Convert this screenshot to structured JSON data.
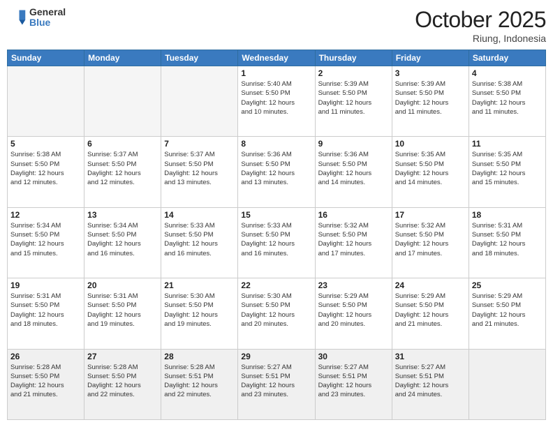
{
  "header": {
    "logo": {
      "general": "General",
      "blue": "Blue"
    },
    "title": "October 2025",
    "location": "Riung, Indonesia"
  },
  "weekdays": [
    "Sunday",
    "Monday",
    "Tuesday",
    "Wednesday",
    "Thursday",
    "Friday",
    "Saturday"
  ],
  "weeks": [
    [
      {
        "day": "",
        "info": ""
      },
      {
        "day": "",
        "info": ""
      },
      {
        "day": "",
        "info": ""
      },
      {
        "day": "1",
        "info": "Sunrise: 5:40 AM\nSunset: 5:50 PM\nDaylight: 12 hours\nand 10 minutes."
      },
      {
        "day": "2",
        "info": "Sunrise: 5:39 AM\nSunset: 5:50 PM\nDaylight: 12 hours\nand 11 minutes."
      },
      {
        "day": "3",
        "info": "Sunrise: 5:39 AM\nSunset: 5:50 PM\nDaylight: 12 hours\nand 11 minutes."
      },
      {
        "day": "4",
        "info": "Sunrise: 5:38 AM\nSunset: 5:50 PM\nDaylight: 12 hours\nand 11 minutes."
      }
    ],
    [
      {
        "day": "5",
        "info": "Sunrise: 5:38 AM\nSunset: 5:50 PM\nDaylight: 12 hours\nand 12 minutes."
      },
      {
        "day": "6",
        "info": "Sunrise: 5:37 AM\nSunset: 5:50 PM\nDaylight: 12 hours\nand 12 minutes."
      },
      {
        "day": "7",
        "info": "Sunrise: 5:37 AM\nSunset: 5:50 PM\nDaylight: 12 hours\nand 13 minutes."
      },
      {
        "day": "8",
        "info": "Sunrise: 5:36 AM\nSunset: 5:50 PM\nDaylight: 12 hours\nand 13 minutes."
      },
      {
        "day": "9",
        "info": "Sunrise: 5:36 AM\nSunset: 5:50 PM\nDaylight: 12 hours\nand 14 minutes."
      },
      {
        "day": "10",
        "info": "Sunrise: 5:35 AM\nSunset: 5:50 PM\nDaylight: 12 hours\nand 14 minutes."
      },
      {
        "day": "11",
        "info": "Sunrise: 5:35 AM\nSunset: 5:50 PM\nDaylight: 12 hours\nand 15 minutes."
      }
    ],
    [
      {
        "day": "12",
        "info": "Sunrise: 5:34 AM\nSunset: 5:50 PM\nDaylight: 12 hours\nand 15 minutes."
      },
      {
        "day": "13",
        "info": "Sunrise: 5:34 AM\nSunset: 5:50 PM\nDaylight: 12 hours\nand 16 minutes."
      },
      {
        "day": "14",
        "info": "Sunrise: 5:33 AM\nSunset: 5:50 PM\nDaylight: 12 hours\nand 16 minutes."
      },
      {
        "day": "15",
        "info": "Sunrise: 5:33 AM\nSunset: 5:50 PM\nDaylight: 12 hours\nand 16 minutes."
      },
      {
        "day": "16",
        "info": "Sunrise: 5:32 AM\nSunset: 5:50 PM\nDaylight: 12 hours\nand 17 minutes."
      },
      {
        "day": "17",
        "info": "Sunrise: 5:32 AM\nSunset: 5:50 PM\nDaylight: 12 hours\nand 17 minutes."
      },
      {
        "day": "18",
        "info": "Sunrise: 5:31 AM\nSunset: 5:50 PM\nDaylight: 12 hours\nand 18 minutes."
      }
    ],
    [
      {
        "day": "19",
        "info": "Sunrise: 5:31 AM\nSunset: 5:50 PM\nDaylight: 12 hours\nand 18 minutes."
      },
      {
        "day": "20",
        "info": "Sunrise: 5:31 AM\nSunset: 5:50 PM\nDaylight: 12 hours\nand 19 minutes."
      },
      {
        "day": "21",
        "info": "Sunrise: 5:30 AM\nSunset: 5:50 PM\nDaylight: 12 hours\nand 19 minutes."
      },
      {
        "day": "22",
        "info": "Sunrise: 5:30 AM\nSunset: 5:50 PM\nDaylight: 12 hours\nand 20 minutes."
      },
      {
        "day": "23",
        "info": "Sunrise: 5:29 AM\nSunset: 5:50 PM\nDaylight: 12 hours\nand 20 minutes."
      },
      {
        "day": "24",
        "info": "Sunrise: 5:29 AM\nSunset: 5:50 PM\nDaylight: 12 hours\nand 21 minutes."
      },
      {
        "day": "25",
        "info": "Sunrise: 5:29 AM\nSunset: 5:50 PM\nDaylight: 12 hours\nand 21 minutes."
      }
    ],
    [
      {
        "day": "26",
        "info": "Sunrise: 5:28 AM\nSunset: 5:50 PM\nDaylight: 12 hours\nand 21 minutes."
      },
      {
        "day": "27",
        "info": "Sunrise: 5:28 AM\nSunset: 5:50 PM\nDaylight: 12 hours\nand 22 minutes."
      },
      {
        "day": "28",
        "info": "Sunrise: 5:28 AM\nSunset: 5:51 PM\nDaylight: 12 hours\nand 22 minutes."
      },
      {
        "day": "29",
        "info": "Sunrise: 5:27 AM\nSunset: 5:51 PM\nDaylight: 12 hours\nand 23 minutes."
      },
      {
        "day": "30",
        "info": "Sunrise: 5:27 AM\nSunset: 5:51 PM\nDaylight: 12 hours\nand 23 minutes."
      },
      {
        "day": "31",
        "info": "Sunrise: 5:27 AM\nSunset: 5:51 PM\nDaylight: 12 hours\nand 24 minutes."
      },
      {
        "day": "",
        "info": ""
      }
    ]
  ]
}
